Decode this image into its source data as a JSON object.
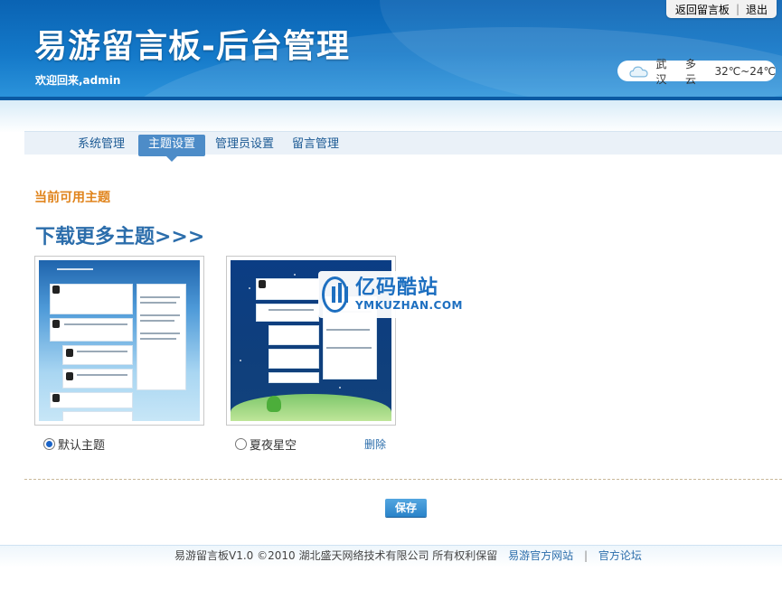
{
  "header": {
    "title": "易游留言板-后台管理",
    "welcome": "欢迎回来,admin",
    "top_links": [
      "返回留言板",
      "退出"
    ],
    "weather": {
      "city": "武汉",
      "condition": "多云",
      "temp": "32℃~24℃",
      "icon": "cloud-icon"
    }
  },
  "nav": {
    "items": [
      {
        "label": "系统管理",
        "active": false
      },
      {
        "label": "主题设置",
        "active": true
      },
      {
        "label": "管理员设置",
        "active": false
      },
      {
        "label": "留言管理",
        "active": false
      }
    ]
  },
  "main": {
    "section_label": "当前可用主题",
    "download_link": "下载更多主题>>>",
    "themes": [
      {
        "name": "默认主题",
        "selected": true
      },
      {
        "name": "夏夜星空",
        "selected": false,
        "delete_label": "删除"
      }
    ],
    "save_label": "保存"
  },
  "watermark": {
    "title": "亿码酷站",
    "subtitle": "YMKUZHAN.COM"
  },
  "footer": {
    "copyright": "易游留言板V1.0 ©2010 湖北盛天网络技术有限公司 所有权利保留",
    "links": [
      "易游官方网站",
      "官方论坛"
    ],
    "separator": "|"
  },
  "colors": {
    "header_blue": "#1479c9",
    "nav_active": "#4d8cc8",
    "section_orange": "#e0841c",
    "link_blue": "#2b6dab"
  }
}
